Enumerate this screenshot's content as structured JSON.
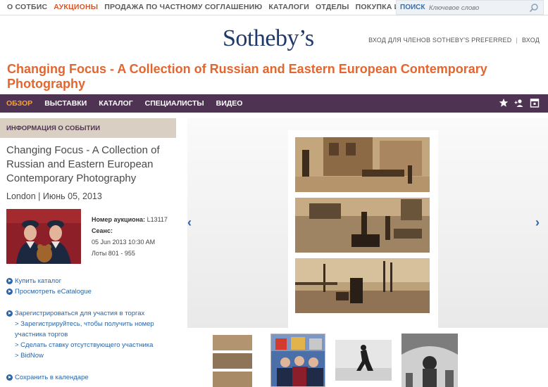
{
  "topnav": {
    "items": [
      "О СОТБИС",
      "АУКЦИОНЫ",
      "ПРОДАЖА ПО ЧАСТНОМУ СОГЛАШЕНИЮ",
      "КАТАЛОГИ",
      "ОТДЕЛЫ",
      "ПОКУПКА И ПРОДАЖА"
    ],
    "active": "АУКЦИОНЫ"
  },
  "search": {
    "label": "ПОИСК",
    "placeholder": "Ключевое слово",
    "value": ""
  },
  "logo": "Sotheby’s",
  "login": {
    "preferred": "ВХОД ДЛЯ ЧЛЕНОВ SOTHEBY'S PREFERRED",
    "sep": "|",
    "login": "ВХОД"
  },
  "page_title": "Changing Focus - A Collection of Russian and Eastern European Contemporary Photography",
  "subnav": {
    "items": [
      "ОБЗОР",
      "ВЫСТАВКИ",
      "КАТАЛОГ",
      "СПЕЦИАЛИСТЫ",
      "ВИДЕО"
    ],
    "active": "ОБЗОР",
    "tools": [
      "star-icon",
      "add-user-icon",
      "calendar-icon"
    ]
  },
  "event": {
    "header": "ИНФОРМАЦИЯ О СОБЫТИИ",
    "title": "Changing Focus - A Collection of Russian and Eastern European Contemporary Photography",
    "location_date": "London | Июнь 05, 2013",
    "sale_number_label": "Номер аукциона:",
    "sale_number": "L13117",
    "session_label": "Сеанс:",
    "session_time": "05 Jun 2013 10:30 AM",
    "lots": "Лоты 801 - 955"
  },
  "links": {
    "buy_catalogue": "Купить каталог",
    "view_ecatalogue": "Просмотреть eCatalogue",
    "register": "Зарегистрироваться для участия в торгах",
    "register_sub": [
      "> Зарегистрируйтесь, чтобы получить номер участника торгов",
      "> Сделать ставку отсутствующего участника",
      "> BidNow"
    ],
    "save_calendar": "Сохранить в календаре"
  },
  "viewer": {
    "prev": "‹",
    "next": "›"
  },
  "colors": {
    "accent": "#e3662f",
    "nav_bar": "#4e3452",
    "link": "#2a66a8",
    "active_tab": "#f3a23a"
  }
}
